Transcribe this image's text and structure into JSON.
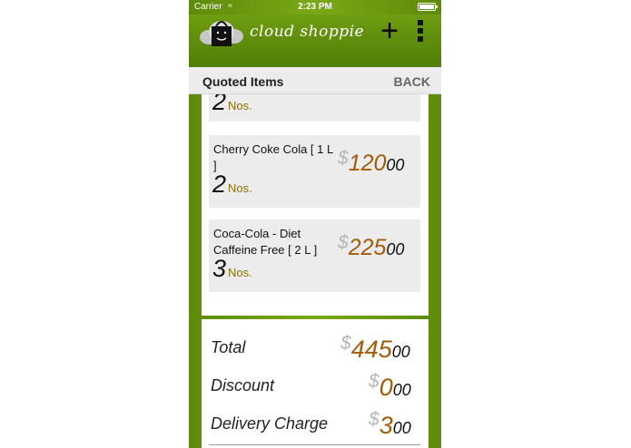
{
  "status_bar": {
    "carrier": "Carrier",
    "time": "2:23 PM"
  },
  "app_bar": {
    "title": "cloud shoppie",
    "add_label": "+",
    "logo_icon": "shopping-bag-cloud-icon",
    "menu_icon": "vertical-dots-menu-icon"
  },
  "sub_header": {
    "title": "Quoted Items",
    "back_label": "BACK"
  },
  "items": [
    {
      "name": "",
      "qty": "2",
      "unit": "Nos.",
      "currency": "",
      "price_whole": "",
      "price_cents": ""
    },
    {
      "name": "Cherry Coke Cola [ 1 L ]",
      "qty": "2",
      "unit": "Nos.",
      "currency": "$",
      "price_whole": "120",
      "price_cents": "00"
    },
    {
      "name": "Coca-Cola - Diet Caffeine Free [ 2 L ]",
      "qty": "3",
      "unit": "Nos.",
      "currency": "$",
      "price_whole": "225",
      "price_cents": "00"
    }
  ],
  "summary": {
    "total_label": "Total",
    "total_currency": "$",
    "total_whole": "445",
    "total_cents": "00",
    "discount_label": "Discount",
    "discount_currency": "$",
    "discount_whole": "0",
    "discount_cents": "00",
    "delivery_label": "Delivery Charge",
    "delivery_currency": "$",
    "delivery_whole": "3",
    "delivery_cents": "00"
  },
  "colors": {
    "brand_green": "#6f9d12",
    "price_brown": "#a35b07",
    "unit_olive": "#8a7200"
  }
}
